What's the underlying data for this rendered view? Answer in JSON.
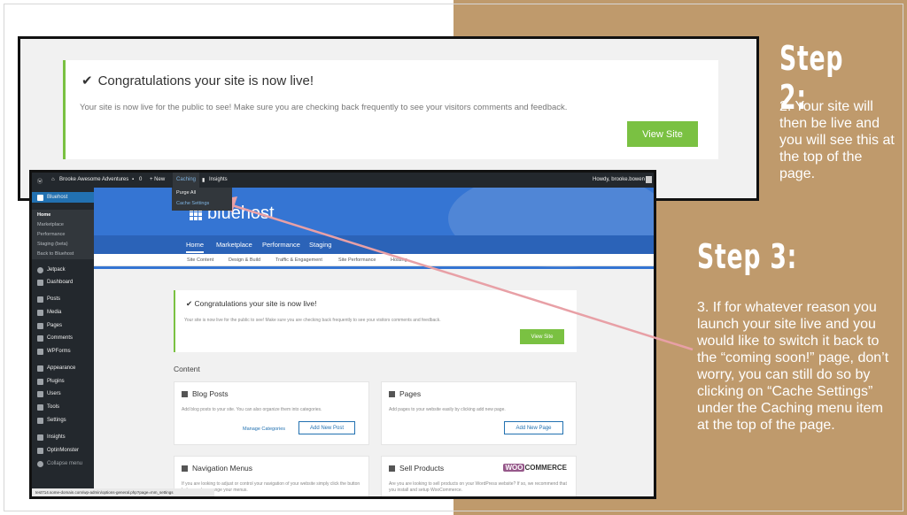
{
  "step2": {
    "title": "Step 2:",
    "text": "2. Your site will then be live and you will see this at the top of the page."
  },
  "step3": {
    "title": "Step 3:",
    "text": "3. If for whatever reason you launch your site live and you would like to switch it back to the “coming soon!” page, don’t worry, you can still do so by clicking on “Cache Settings” under the Caching menu item at the top of the page."
  },
  "shot1": {
    "check": "✔",
    "title": "Congratulations your site is now live!",
    "desc": "Your site is now live for the public to see! Make sure you are checking back frequently to see your visitors comments and feedback.",
    "button": "View Site"
  },
  "shot2": {
    "adminbar": {
      "wp_logo": "ⓦ",
      "site_name": "Brooke Awesome Adventures",
      "comments_count": "0",
      "new": "+ New",
      "caching": "Caching",
      "insights": "Insights",
      "howdy": "Howdy, brooke.bowen"
    },
    "dropdown": {
      "purge_all": "Purge All",
      "cache_settings": "Cache Settings"
    },
    "sidebar": {
      "bluehost": "Bluehost",
      "sub_items": [
        "Home",
        "Marketplace",
        "Performance",
        "Staging (beta)",
        "Back to Bluehost"
      ],
      "items": [
        "Jetpack",
        "Dashboard",
        "Posts",
        "Media",
        "Pages",
        "Comments",
        "WPForms",
        "Appearance",
        "Plugins",
        "Users",
        "Tools",
        "Settings",
        "Insights",
        "OptinMonster",
        "Collapse menu"
      ]
    },
    "banner": {
      "logo": "bluehost",
      "tabs": [
        "Home",
        "Marketplace",
        "Performance",
        "Staging"
      ]
    },
    "subnav": [
      "Site Content",
      "Design & Build",
      "Traffic & Engagement",
      "Site Performance",
      "Hosting"
    ],
    "notice": {
      "check": "✔",
      "title": "Congratulations your site is now live!",
      "desc": "Your site is now live for the public to see! Make sure you are checking back frequently to see your visitors comments and feedback.",
      "button": "View Site"
    },
    "content_heading": "Content",
    "cards": {
      "blog": {
        "title": "Blog Posts",
        "desc": "Add blog posts to your site. You can also organize them into categories.",
        "link": "Manage Categories",
        "button": "Add New Post"
      },
      "pages": {
        "title": "Pages",
        "desc": "Add pages to your website easily by clicking add new page.",
        "button": "Add New Page"
      },
      "nav": {
        "title": "Navigation Menus",
        "desc": "If you are looking to adjust or control your navigation of your website simply click the button below and rearrange your menus."
      },
      "sell": {
        "title": "Sell Products",
        "desc": "Are you are looking to sell products on your WordPress website? If so, we recommend that you install and setup WooCommerce.",
        "woo_w": "WOO",
        "woo_rest": "COMMERCE"
      }
    },
    "status_url": "test714.some-domain.com/wp-admin/options-general.php?page=mm_settings"
  },
  "colors": {
    "tan": "#bf9a6c",
    "green": "#7ac142",
    "bluehost_blue": "#3575d3",
    "wp_dark": "#23282d",
    "arrow": "#e8a0a6"
  }
}
